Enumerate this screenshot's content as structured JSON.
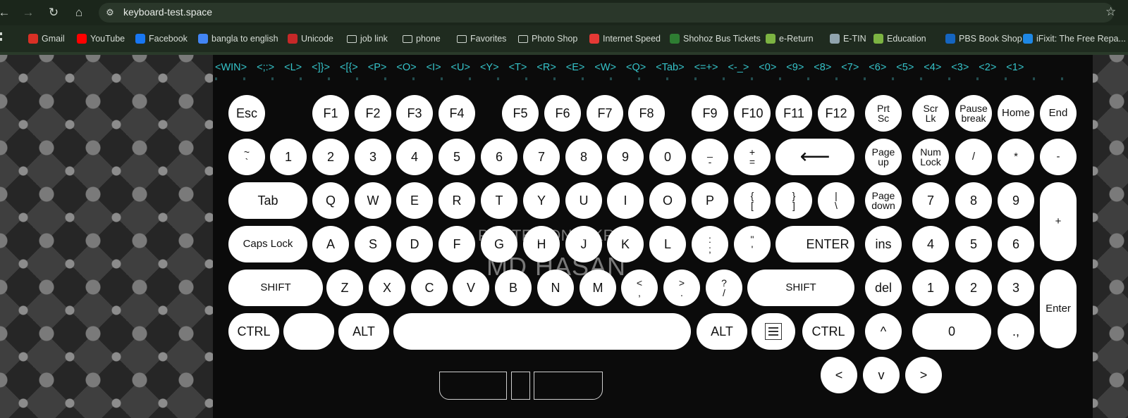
{
  "browser": {
    "url": "keyboard-test.space",
    "icons": {
      "back": "arrow-left-icon",
      "forward": "arrow-right-icon",
      "reload": "reload-icon",
      "home": "home-icon",
      "site": "site-settings-icon",
      "star": "star-icon"
    },
    "bookmarks": [
      {
        "label": "Gmail",
        "icon": "gmail-icon",
        "color": "#d93025"
      },
      {
        "label": "YouTube",
        "icon": "youtube-icon",
        "color": "#ff0000"
      },
      {
        "label": "Facebook",
        "icon": "facebook-icon",
        "color": "#1877f2"
      },
      {
        "label": "bangla to english",
        "icon": "google-icon",
        "color": "#4285f4"
      },
      {
        "label": "Unicode",
        "icon": "unicode-icon",
        "color": "#c62828"
      },
      {
        "label": "job link",
        "icon": "folder-icon",
        "color": ""
      },
      {
        "label": "phone",
        "icon": "folder-icon",
        "color": ""
      },
      {
        "label": "Favorites",
        "icon": "folder-icon",
        "color": ""
      },
      {
        "label": "Photo Shop",
        "icon": "folder-icon",
        "color": ""
      },
      {
        "label": "Internet Speed",
        "icon": "speedtest-icon",
        "color": "#e53935"
      },
      {
        "label": "Shohoz  Bus Tickets",
        "icon": "shohoz-icon",
        "color": "#2e7d32"
      },
      {
        "label": "e-Return",
        "icon": "ereturn-icon",
        "color": "#7cb342"
      },
      {
        "label": "E-TIN",
        "icon": "etin-icon",
        "color": "#90a4ae"
      },
      {
        "label": "Education",
        "icon": "education-icon",
        "color": "#7cb342"
      },
      {
        "label": "PBS Book Shop",
        "icon": "pbs-icon",
        "color": "#1565c0"
      },
      {
        "label": "iFixit: The Free Repa...",
        "icon": "ifixit-icon",
        "color": "#1e88e5"
      }
    ]
  },
  "log": [
    "<WIN>",
    "<;:>",
    "<L>",
    "<]}>",
    "<[{>",
    "<P>",
    "<O>",
    "<I>",
    "<U>",
    "<Y>",
    "<T>",
    "<R>",
    "<E>",
    "<W>",
    "<Q>",
    "<Tab>",
    "<=+>",
    "<-_>",
    "<0>",
    "<9>",
    "<8>",
    "<7>",
    "<6>",
    "<5>",
    "<4>",
    "<3>",
    "<2>",
    "<1>"
  ],
  "watermark": {
    "line1": "POSTED ON BIKROY",
    "line2": "MD HASAN"
  },
  "keys": {
    "esc": "Esc",
    "f1": "F1",
    "f2": "F2",
    "f3": "F3",
    "f4": "F4",
    "f5": "F5",
    "f6": "F6",
    "f7": "F7",
    "f8": "F8",
    "f9": "F9",
    "f10": "F10",
    "f11": "F11",
    "f12": "F12",
    "prtsc_1": "Prt",
    "prtsc_2": "Sc",
    "scrlk_1": "Scr",
    "scrlk_2": "Lk",
    "pause_1": "Pause",
    "pause_2": "break",
    "home": "Home",
    "end": "End",
    "tilde_1": "~",
    "tilde_2": "`",
    "d1": "1",
    "d2": "2",
    "d3": "3",
    "d4": "4",
    "d5": "5",
    "d6": "6",
    "d7": "7",
    "d8": "8",
    "d9": "9",
    "d0": "0",
    "minus_1": "_",
    "minus_2": "-",
    "plus_1": "+",
    "plus_2": "=",
    "backspace": "⟵",
    "pgup_1": "Page",
    "pgup_2": "up",
    "numlock_1": "Num",
    "numlock_2": "Lock",
    "np_div": "/",
    "np_mul": "*",
    "np_sub": "-",
    "tab": "Tab",
    "q": "Q",
    "w": "W",
    "e": "E",
    "r": "R",
    "t": "T",
    "y": "Y",
    "u": "U",
    "i": "I",
    "o": "O",
    "p": "P",
    "lbr_1": "{",
    "lbr_2": "[",
    "rbr_1": "}",
    "rbr_2": "]",
    "bsl_1": "|",
    "bsl_2": "\\",
    "pgdn_1": "Page",
    "pgdn_2": "down",
    "np7": "7",
    "np8": "8",
    "np9": "9",
    "np_add": "+",
    "caps": "Caps Lock",
    "a": "A",
    "s": "S",
    "d": "D",
    "f": "F",
    "g": "G",
    "h": "H",
    "j": "J",
    "k": "K",
    "l": "L",
    "semi_1": ":",
    "semi_2": ";",
    "quote_1": "\"",
    "quote_2": "'",
    "enter": "ENTER",
    "ins": "ins",
    "np4": "4",
    "np5": "5",
    "np6": "6",
    "lshift": "SHIFT",
    "z": "Z",
    "x": "X",
    "c": "C",
    "v": "V",
    "b": "B",
    "n": "N",
    "m": "M",
    "comma_1": "<",
    "comma_2": ",",
    "period_1": ">",
    "period_2": ".",
    "slash_1": "?",
    "slash_2": "/",
    "rshift": "SHIFT",
    "del": "del",
    "np1": "1",
    "np2": "2",
    "np3": "3",
    "np_enter": "Enter",
    "lctrl": "CTRL",
    "lwin": "",
    "lalt": "ALT",
    "space": "",
    "ralt": "ALT",
    "rctrl": "CTRL",
    "up": "^",
    "np0": "0",
    "np_dot": ".,",
    "left": "<",
    "down": "v",
    "right": ">"
  }
}
